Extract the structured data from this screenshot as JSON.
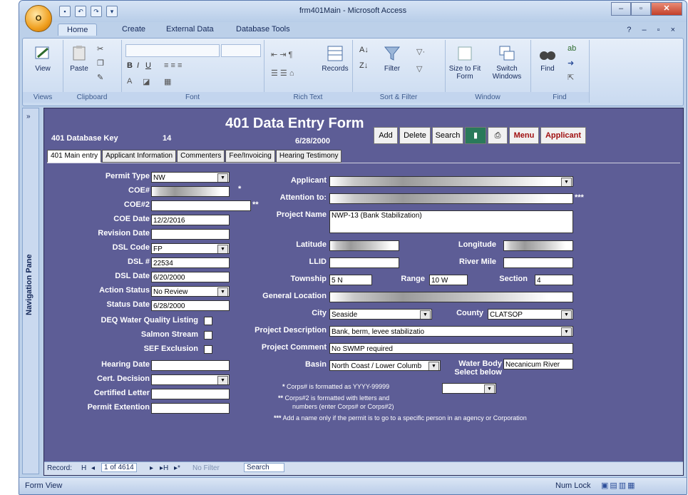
{
  "window": {
    "title": "frm401Main - Microsoft Access",
    "office_button": "O",
    "minimize": "–",
    "restore": "▫",
    "close": "✕",
    "help_controls": "? – ▫ ×"
  },
  "ribbon": {
    "tabs": [
      "Home",
      "Create",
      "External Data",
      "Database Tools"
    ],
    "groups": {
      "views": {
        "label": "Views",
        "buttons": [
          "View"
        ]
      },
      "clipboard": {
        "label": "Clipboard",
        "buttons": [
          "Paste"
        ]
      },
      "font": {
        "label": "Font"
      },
      "rich_text": {
        "label": "Rich Text",
        "buttons": [
          "Records"
        ]
      },
      "sort_filter": {
        "label": "Sort & Filter",
        "buttons": [
          "Filter"
        ]
      },
      "window": {
        "label": "Window",
        "buttons": [
          "Size to Fit Form",
          "Switch Windows"
        ]
      },
      "find": {
        "label": "Find",
        "buttons": [
          "Find"
        ]
      }
    }
  },
  "nav_pane": {
    "chevron": "»",
    "label": "Navigation Pane"
  },
  "form": {
    "title": "401 Data Entry Form",
    "date": "6/28/2000",
    "db_key_label": "401 Database Key",
    "db_key_value": "14",
    "buttons": [
      "Add",
      "Delete",
      "Search",
      "Menu",
      "Applicant"
    ],
    "tabs": [
      "401 Main entry",
      "Applicant Information",
      "Commenters",
      "Fee/Invoicing",
      "Hearing Testimony"
    ],
    "left_fields": [
      {
        "label": "Permit Type",
        "value": "NW",
        "dropdown": true
      },
      {
        "label": "COE#",
        "value": "",
        "blur": true
      },
      {
        "label": "COE#2",
        "value": ""
      },
      {
        "label": "COE Date",
        "value": "12/2/2016"
      },
      {
        "label": "Revision Date",
        "value": ""
      },
      {
        "label": "DSL Code",
        "value": "FP",
        "dropdown": true
      },
      {
        "label": "DSL #",
        "value": "22534"
      },
      {
        "label": "DSL Date",
        "value": "6/20/2000"
      },
      {
        "label": "Action Status",
        "value": "No Review",
        "dropdown": true
      },
      {
        "label": "Status Date",
        "value": "6/28/2000"
      }
    ],
    "checkboxes": [
      "DEQ Water Quality Listing",
      "Salmon Stream",
      "SEF Exclusion"
    ],
    "left_bottom_fields": [
      {
        "label": "Hearing Date",
        "value": ""
      },
      {
        "label": "Cert. Decision",
        "value": "",
        "dropdown": true
      },
      {
        "label": "Certified Letter",
        "value": ""
      },
      {
        "label": "Permit Extention",
        "value": ""
      }
    ],
    "applicant_label": "Applicant",
    "attention_label": "Attention to:",
    "project_name_label": "Project Name",
    "project_name_value": "NWP-13 (Bank Stabilization)",
    "latitude_label": "Latitude",
    "longitude_label": "Longitude",
    "llid_label": "LLID",
    "river_mile_label": "River Mile",
    "township_label": "Township",
    "township_value": "5 N",
    "range_label": "Range",
    "range_value": "10 W",
    "section_label": "Section",
    "section_value": "4",
    "general_location_label": "General Location",
    "city_label": "City",
    "city_value": "Seaside",
    "county_label": "County",
    "county_value": "CLATSOP",
    "project_description_label": "Project Description",
    "project_description_value": "Bank, berm, levee stabilizatio",
    "project_comment_label": "Project Comment",
    "project_comment_value": "No SWMP required",
    "basin_label": "Basin",
    "basin_value": "North Coast / Lower Columb",
    "water_body_label": "Water Body",
    "water_body_value": "Necanicum River",
    "select_below_label": "Select below",
    "stars": {
      "one": "*",
      "two": "**",
      "three": "***"
    },
    "notes": [
      "Corps# is formatted as YYYY-99999",
      "Corps#2 is formatted with letters and",
      "numbers (enter Corps# or Corps#2)",
      "Add a name only if the permit is to go to a specific person in an agency or Corporation"
    ]
  },
  "record_nav": {
    "label": "Record:",
    "first": "H",
    "prev": "◂",
    "position": "1 of 4614",
    "next": "▸",
    "last": "▸H",
    "new": "▸*",
    "no_filter": "No Filter",
    "search": "Search"
  },
  "status_bar": {
    "left": "Form View",
    "num_lock": "Num Lock"
  }
}
